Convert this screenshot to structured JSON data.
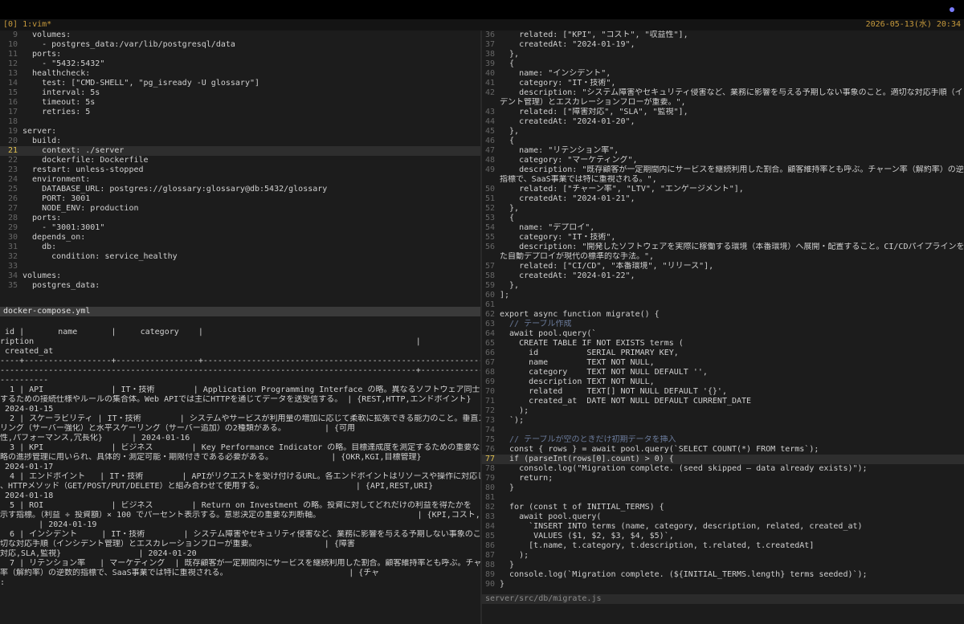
{
  "tmux": {
    "window_label": "[0] 1:vim*",
    "datetime": "2026-05-13(水) 20:34"
  },
  "top_left_pane": {
    "filename": "docker-compose.yml",
    "current_line": 21,
    "lines": [
      {
        "n": 9,
        "text": "  volumes:"
      },
      {
        "n": 10,
        "text": "    - postgres_data:/var/lib/postgresql/data"
      },
      {
        "n": 11,
        "text": "  ports:"
      },
      {
        "n": 12,
        "text": "    - \"5432:5432\""
      },
      {
        "n": 13,
        "text": "  healthcheck:"
      },
      {
        "n": 14,
        "text": "    test: [\"CMD-SHELL\", \"pg_isready -U glossary\"]"
      },
      {
        "n": 15,
        "text": "    interval: 5s"
      },
      {
        "n": 16,
        "text": "    timeout: 5s"
      },
      {
        "n": 17,
        "text": "    retries: 5"
      },
      {
        "n": 18,
        "text": ""
      },
      {
        "n": 19,
        "text": "server:"
      },
      {
        "n": 20,
        "text": "  build:"
      },
      {
        "n": 21,
        "text": "    context: ./server"
      },
      {
        "n": 22,
        "text": "    dockerfile: Dockerfile"
      },
      {
        "n": 23,
        "text": "  restart: unless-stopped"
      },
      {
        "n": 24,
        "text": "  environment:"
      },
      {
        "n": 25,
        "text": "    DATABASE_URL: postgres://glossary:glossary@db:5432/glossary"
      },
      {
        "n": 26,
        "text": "    PORT: 3001"
      },
      {
        "n": 27,
        "text": "    NODE_ENV: production"
      },
      {
        "n": 28,
        "text": "  ports:"
      },
      {
        "n": 29,
        "text": "    - \"3001:3001\""
      },
      {
        "n": 30,
        "text": "  depends_on:"
      },
      {
        "n": 31,
        "text": "    db:"
      },
      {
        "n": 32,
        "text": "      condition: service_healthy"
      },
      {
        "n": 33,
        "text": ""
      },
      {
        "n": 34,
        "text": "volumes:"
      },
      {
        "n": 35,
        "text": "  postgres_data:"
      }
    ]
  },
  "bottom_left_pane": {
    "rows": [
      " id |       name       |     category    |                                                                                    desc",
      "ription                                                                               |              related              |",
      " created_at",
      "----+------------------+-----------------+----------------------------------------------------------------------------------------",
      "--------------------------------------------------------------------------------------+-----------------------------------+---",
      "----------",
      "  1 | API              | IT・技術        | Application Programming Interface の略。異なるソフトウェア同士が情報をやり取り",
      "するための接続仕様やルールの集合体。Web APIでは主にHTTPを通じてデータを送受信する。 | {REST,HTTP,エンドポイント}        |",
      " 2024-01-15",
      "  2 | スケーラビリティ | IT・技術        | システムやサービスが利用量の増加に応じて柔軟に拡張できる能力のこと。垂直スケー",
      "リング（サーバー強化）と水平スケーリング（サーバー追加）の2種類がある。        | {可用",
      "性,パフォーマンス,冗長化}      | 2024-01-16",
      "  3 | KPI              | ビジネス        | Key Performance Indicator の略。目標達成度を測定するための重要な定量的指標。事業戦",
      "略の進捗管理に用いられ、具体的・測定可能・期限付きである必要がある。            | {OKR,KGI,目標管理}                |",
      " 2024-01-17",
      "  4 | エンドポイント   | IT・技術        | APIがリクエストを受け付けるURL。各エンドポイントはリソースや操作に対応しており",
      "、HTTPメソッド（GET/POST/PUT/DELETE）と組み合わせて使用する。                   | {API,REST,URI}                    |",
      " 2024-01-18",
      "  5 | ROI              | ビジネス        | Return on Investment の略。投資に対してどれだけの利益を得たかを",
      "示す指標。（利益 ÷ 投資額）× 100 でパーセント表示する。意思決定の重要な判断軸。                    | {KPI,コスト,収益性}",
      "        | 2024-01-19",
      "  6 | インシデント     | IT・技術        | システム障害やセキュリティ侵害など、業務に影響を与える予期しない事象のこと。適",
      "切な対応手順（インシデント管理）とエスカレーションフローが重要。              | {障害",
      "対応,SLA,監視}                | 2024-01-20",
      "  7 | リテンション率   | マーケティング  | 既存顧客が一定期間内にサービスを継続利用した割合。顧客維持率とも呼ぶ。チャーン",
      "率（解約率）の逆数的指標で、SaaS事業では特に重視される。                         | {チャ",
      ":"
    ]
  },
  "right_pane": {
    "filename": "server/src/db/migrate.js",
    "current_line": 77,
    "lines": [
      {
        "n": "36",
        "text": "    related: [\"KPI\", \"コスト\", \"収益性\"],"
      },
      {
        "n": "37",
        "text": "    createdAt: \"2024-01-19\","
      },
      {
        "n": "38",
        "text": "  },"
      },
      {
        "n": "39",
        "text": "  {"
      },
      {
        "n": "40",
        "text": "    name: \"インシデント\","
      },
      {
        "n": "41",
        "text": "    category: \"IT・技術\","
      },
      {
        "n": "42",
        "text": "    description: \"システム障害やセキュリティ侵害など、業務に影響を与える予期しない事象のこと。適切な対応手順（インシ"
      },
      {
        "n": "",
        "text": "デント管理）とエスカレーションフローが重要。\","
      },
      {
        "n": "43",
        "text": "    related: [\"障害対応\", \"SLA\", \"監視\"],"
      },
      {
        "n": "44",
        "text": "    createdAt: \"2024-01-20\","
      },
      {
        "n": "45",
        "text": "  },"
      },
      {
        "n": "46",
        "text": "  {"
      },
      {
        "n": "47",
        "text": "    name: \"リテンション率\","
      },
      {
        "n": "48",
        "text": "    category: \"マーケティング\","
      },
      {
        "n": "49",
        "text": "    description: \"既存顧客が一定期間内にサービスを継続利用した割合。顧客維持率とも呼ぶ。チャーン率（解約率）の逆数的"
      },
      {
        "n": "",
        "text": "指標で、SaaS事業では特に重視される。\","
      },
      {
        "n": "50",
        "text": "    related: [\"チャーン率\", \"LTV\", \"エンゲージメント\"],"
      },
      {
        "n": "51",
        "text": "    createdAt: \"2024-01-21\","
      },
      {
        "n": "52",
        "text": "  },"
      },
      {
        "n": "53",
        "text": "  {"
      },
      {
        "n": "54",
        "text": "    name: \"デプロイ\","
      },
      {
        "n": "55",
        "text": "    category: \"IT・技術\","
      },
      {
        "n": "56",
        "text": "    description: \"開発したソフトウェアを実際に稼働する環境（本番環境）へ展開・配置すること。CI/CDパイプラインを通じ"
      },
      {
        "n": "",
        "text": "た自動デプロイが現代の標準的な手法。\","
      },
      {
        "n": "57",
        "text": "    related: [\"CI/CD\", \"本番環境\", \"リリース\"],"
      },
      {
        "n": "58",
        "text": "    createdAt: \"2024-01-22\","
      },
      {
        "n": "59",
        "text": "  },"
      },
      {
        "n": "60",
        "text": "];"
      },
      {
        "n": "61",
        "text": ""
      },
      {
        "n": "62",
        "text": "export async function migrate() {"
      },
      {
        "n": "63",
        "text": "  // テーブル作成"
      },
      {
        "n": "64",
        "text": "  await pool.query(`"
      },
      {
        "n": "65",
        "text": "    CREATE TABLE IF NOT EXISTS terms ("
      },
      {
        "n": "66",
        "text": "      id          SERIAL PRIMARY KEY,"
      },
      {
        "n": "67",
        "text": "      name        TEXT NOT NULL,"
      },
      {
        "n": "68",
        "text": "      category    TEXT NOT NULL DEFAULT '',"
      },
      {
        "n": "69",
        "text": "      description TEXT NOT NULL,"
      },
      {
        "n": "70",
        "text": "      related     TEXT[] NOT NULL DEFAULT '{}',"
      },
      {
        "n": "71",
        "text": "      created_at  DATE NOT NULL DEFAULT CURRENT_DATE"
      },
      {
        "n": "72",
        "text": "    );"
      },
      {
        "n": "73",
        "text": "  `);"
      },
      {
        "n": "74",
        "text": ""
      },
      {
        "n": "75",
        "text": "  // テーブルが空のときだけ初期データを挿入"
      },
      {
        "n": "76",
        "text": "  const { rows } = await pool.query(`SELECT COUNT(*) FROM terms`);"
      },
      {
        "n": "77",
        "text": "  if (parseInt(rows[0].count) > 0) {"
      },
      {
        "n": "78",
        "text": "    console.log(\"Migration complete. (seed skipped — data already exists)\");"
      },
      {
        "n": "79",
        "text": "    return;"
      },
      {
        "n": "80",
        "text": "  }"
      },
      {
        "n": "81",
        "text": ""
      },
      {
        "n": "82",
        "text": "  for (const t of INITIAL_TERMS) {"
      },
      {
        "n": "83",
        "text": "    await pool.query("
      },
      {
        "n": "84",
        "text": "      `INSERT INTO terms (name, category, description, related, created_at)"
      },
      {
        "n": "85",
        "text": "       VALUES ($1, $2, $3, $4, $5)`,"
      },
      {
        "n": "86",
        "text": "      [t.name, t.category, t.description, t.related, t.createdAt]"
      },
      {
        "n": "87",
        "text": "    );"
      },
      {
        "n": "88",
        "text": "  }"
      },
      {
        "n": "89",
        "text": "  console.log(`Migration complete. (${INITIAL_TERMS.length} terms seeded)`);"
      },
      {
        "n": "90",
        "text": "}"
      }
    ]
  }
}
